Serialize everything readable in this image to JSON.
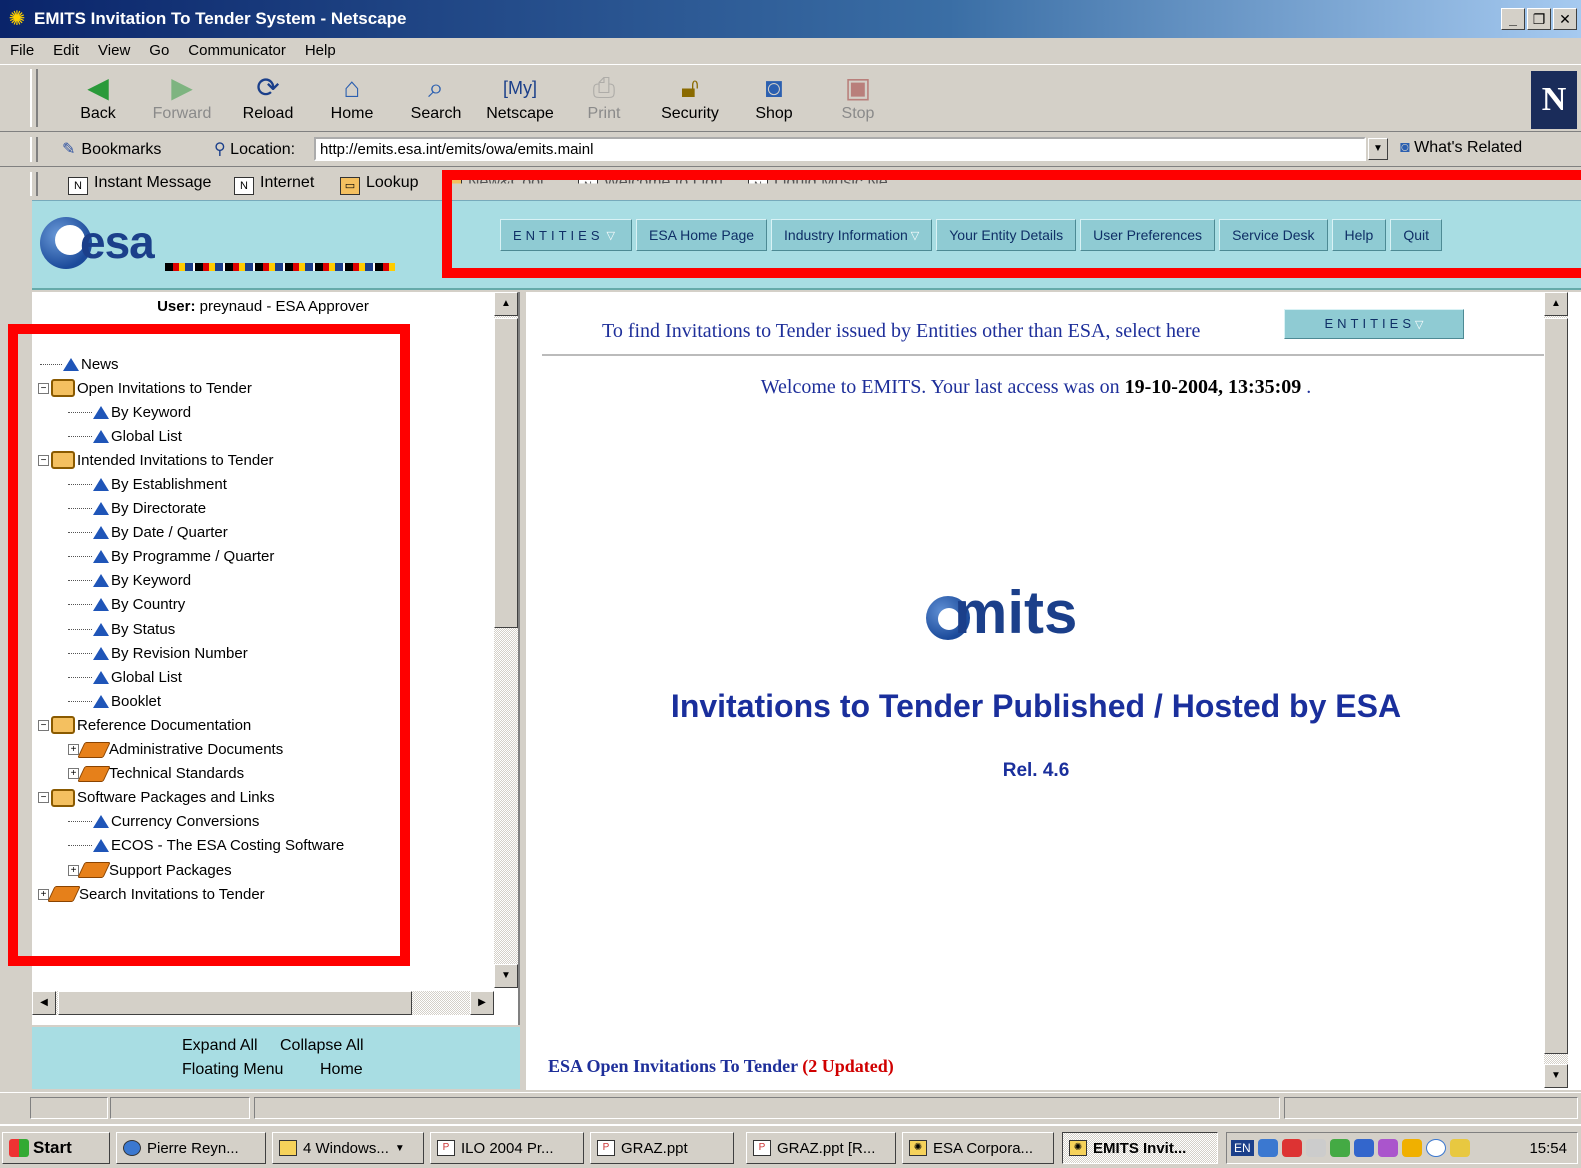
{
  "window": {
    "title": "EMITS Invitation To Tender System - Netscape"
  },
  "menu": [
    "File",
    "Edit",
    "View",
    "Go",
    "Communicator",
    "Help"
  ],
  "toolbar": {
    "back": "Back",
    "forward": "Forward",
    "reload": "Reload",
    "home": "Home",
    "search": "Search",
    "netscape": "Netscape",
    "print": "Print",
    "security": "Security",
    "shop": "Shop",
    "stop": "Stop"
  },
  "location": {
    "bookmarks": "Bookmarks",
    "label": "Location:",
    "url": "http://emits.esa.int/emits/owa/emits.mainl",
    "whats_related": "What's Related"
  },
  "personal": {
    "instant_message": "Instant Message",
    "internet": "Internet",
    "lookup": "Lookup",
    "newcool": "New&Cool",
    "welcome": "Welcome to Liqu",
    "liquid": "Liquid Music Ne"
  },
  "header": {
    "logo_text": "esa",
    "nav": {
      "entities": "ENTITIES",
      "esa_home": "ESA Home Page",
      "industry_info": "Industry Information",
      "entity_details": "Your Entity Details",
      "user_prefs": "User Preferences",
      "service_desk": "Service Desk",
      "help": "Help",
      "quit": "Quit"
    }
  },
  "left": {
    "user_label": "User:",
    "user_value": "preynaud - ESA Approver",
    "tree": {
      "news": "News",
      "open_itt": "Open Invitations to Tender",
      "open_by_keyword": "By Keyword",
      "open_global": "Global List",
      "intended_itt": "Intended Invitations to Tender",
      "by_establishment": "By Establishment",
      "by_directorate": "By Directorate",
      "by_date": "By Date / Quarter",
      "by_programme": "By Programme / Quarter",
      "int_by_keyword": "By Keyword",
      "by_country": "By Country",
      "by_status": "By Status",
      "by_revision": "By Revision Number",
      "int_global": "Global List",
      "booklet": "Booklet",
      "ref_docs": "Reference Documentation",
      "admin_docs": "Administrative Documents",
      "tech_standards": "Technical Standards",
      "software": "Software Packages and Links",
      "currency": "Currency Conversions",
      "ecos": "ECOS - The ESA Costing Software",
      "support": "Support Packages",
      "search_itt": "Search Invitations to Tender"
    },
    "footer": {
      "expand_all": "Expand All",
      "collapse_all": "Collapse All",
      "floating_menu": "Floating Menu",
      "home": "Home"
    }
  },
  "main": {
    "entities_prompt": "To find Invitations to Tender issued by Entities other than ESA, select here",
    "entities_button": "ENTITIES",
    "welcome_prefix": "Welcome to EMITS. Your last access was on",
    "last_access": "19-10-2004, 13:35:09",
    "welcome_suffix": ".",
    "logo_text": "mits",
    "heading": "Invitations to Tender Published / Hosted by ESA",
    "release": "Rel. 4.6",
    "open_itt_label": "ESA Open Invitations To Tender",
    "open_itt_updated": "(2 Updated)"
  },
  "taskbar": {
    "start": "Start",
    "tasks": [
      "Pierre Reyn...",
      "4 Windows...",
      "ILO 2004 Pr...",
      "GRAZ.ppt",
      "GRAZ.ppt [R...",
      "ESA Corpora...",
      "EMITS Invit..."
    ],
    "lang": "EN",
    "clock": "15:54"
  },
  "colors": {
    "highlight": "#ff0000",
    "header_bg": "#a8dde3",
    "link_blue": "#1e2f9a"
  }
}
